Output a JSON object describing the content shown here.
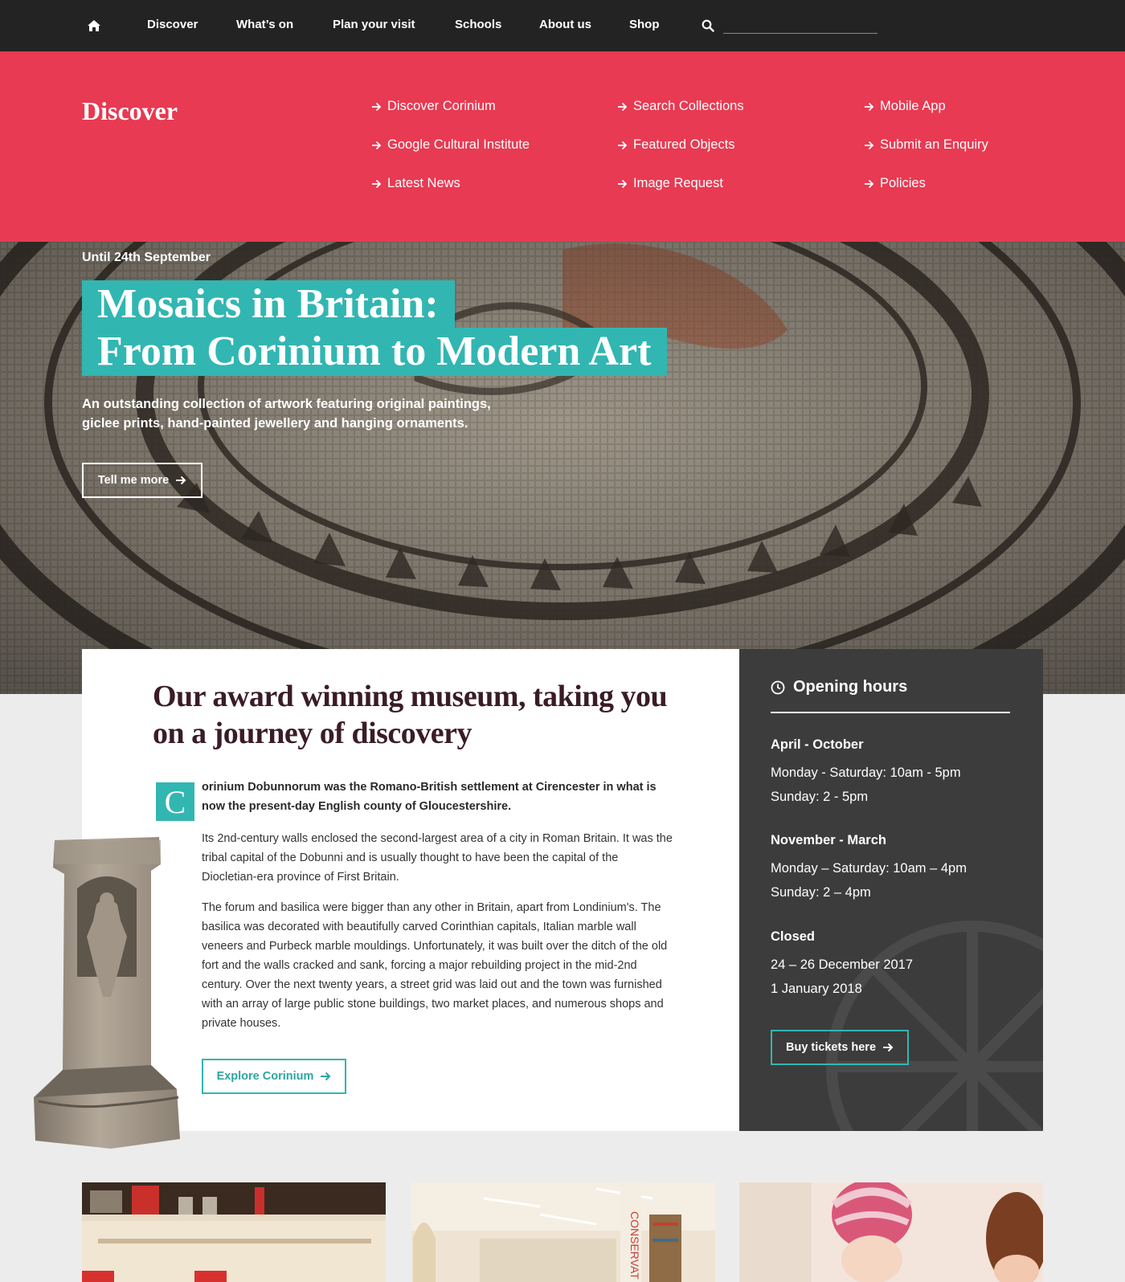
{
  "nav": {
    "items": [
      "Discover",
      "What’s on",
      "Plan your visit",
      "Schools",
      "About us",
      "Shop"
    ],
    "search_placeholder": ""
  },
  "discover_menu": {
    "title": "Discover",
    "links": [
      "Discover Corinium",
      "Google Cultural Institute",
      "Latest News",
      "Search Collections",
      "Featured Objects",
      "Image Request",
      "Mobile App",
      "Submit an Enquiry",
      "Policies"
    ]
  },
  "hero": {
    "date": "Until 24th September",
    "title_line1": "Mosaics in Britain:",
    "title_line2": "From Corinium to Modern Art",
    "description": "An outstanding collection of artwork featuring original paintings, giclee prints, hand-painted jewellery and hanging ornaments.",
    "button": "Tell me more"
  },
  "intro": {
    "heading": "Our award winning museum, taking you on a journey of discovery",
    "dropcap": "C",
    "lead": "orinium Dobunnorum was the Romano-British settlement at Cirencester in what is now the present-day English county of Gloucestershire.",
    "paragraph1": "Its 2nd-century walls enclosed the second-largest area of a city in Roman Britain. It was the tribal capital of the Dobunni and is usually thought to have been the capital of the Diocletian-era province of First Britain.",
    "paragraph2": "The forum and basilica were bigger than any other in Britain, apart from Londinium's. The basilica was decorated with beautifully carved Corinthian capitals, Italian marble wall veneers and Purbeck marble mouldings. Unfortunately, it was built over the ditch of the old fort and the walls cracked and sank, forcing a major rebuilding project in the mid-2nd century.  Over the next twenty years, a street grid was laid out and the town was furnished with an array of large public stone buildings, two market places, and numerous shops and private houses.",
    "button": "Explore Corinium"
  },
  "hours": {
    "title": "Opening hours",
    "groups": [
      {
        "season": "April - October",
        "lines": [
          "Monday - Saturday: 10am - 5pm",
          "Sunday: 2 - 5pm"
        ]
      },
      {
        "season": "November - March",
        "lines": [
          "Monday – Saturday: 10am – 4pm",
          "Sunday: 2 – 4pm"
        ]
      },
      {
        "season": "Closed",
        "lines": [
          "24 – 26 December 2017",
          "1 January 2018"
        ]
      }
    ],
    "button": "Buy tickets here"
  },
  "promo_images": {
    "middle_sign": "CONSERVAT"
  },
  "colors": {
    "nav_bg": "#232323",
    "menu_bg": "#e83a52",
    "accent_teal": "#32b6b2",
    "hours_bg": "#3c3c3c",
    "heading_plum": "#3a1c26",
    "page_bg": "#ececec"
  },
  "icons": [
    "home-icon",
    "search-icon",
    "arrow-right-icon",
    "clock-icon"
  ]
}
